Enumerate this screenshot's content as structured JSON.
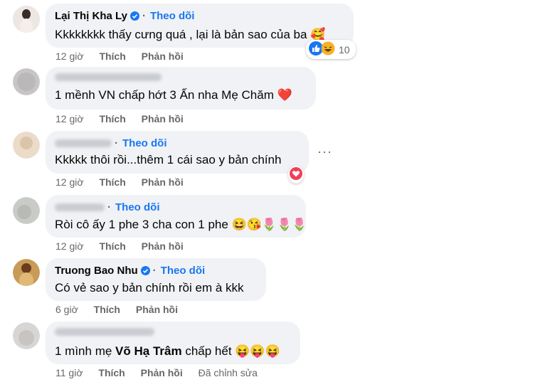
{
  "comments": [
    {
      "name": "Lại Thị Kha Ly",
      "follow": "Theo dõi",
      "text": "Kkkkkkkk thấy cưng quá , lại là bản sao của ba 🥰",
      "time": "12 giờ",
      "like": "Thích",
      "reply": "Phản hồi",
      "reaction_count": "10"
    },
    {
      "name": "",
      "text": "1 mềnh VN chấp hớt 3 Ấn nha Mẹ Chăm ❤️",
      "time": "12 giờ",
      "like": "Thích",
      "reply": "Phản hồi"
    },
    {
      "name": "",
      "follow": "Theo dõi",
      "text": "Kkkkk thôi rồi...thêm 1 cái sao y bản chính",
      "time": "12 giờ",
      "like": "Thích",
      "reply": "Phản hồi"
    },
    {
      "name": "",
      "follow": "Theo dõi",
      "text": "Ròi cô ấy 1 phe 3 cha con 1 phe 😆😘🌷🌷🌷",
      "time": "12 giờ",
      "like": "Thích",
      "reply": "Phản hồi"
    },
    {
      "name": "Truong Bao Nhu",
      "follow": "Theo dõi",
      "text": "Có vẻ sao y bản chính rồi em à kkk",
      "time": "6 giờ",
      "like": "Thích",
      "reply": "Phản hồi"
    },
    {
      "name": "",
      "text_prefix": "1 mình mẹ ",
      "mention": "Võ Hạ Trâm",
      "text_suffix": " chấp hết 😝😝😝",
      "time": "11 giờ",
      "like": "Thích",
      "reply": "Phản hồi",
      "edited": "Đã chỉnh sửa"
    }
  ],
  "more_options": "···",
  "colors": {
    "accent": "#1877f2",
    "bubble": "#f0f2f5",
    "meta": "#65676b",
    "heart": "#f33e58"
  }
}
